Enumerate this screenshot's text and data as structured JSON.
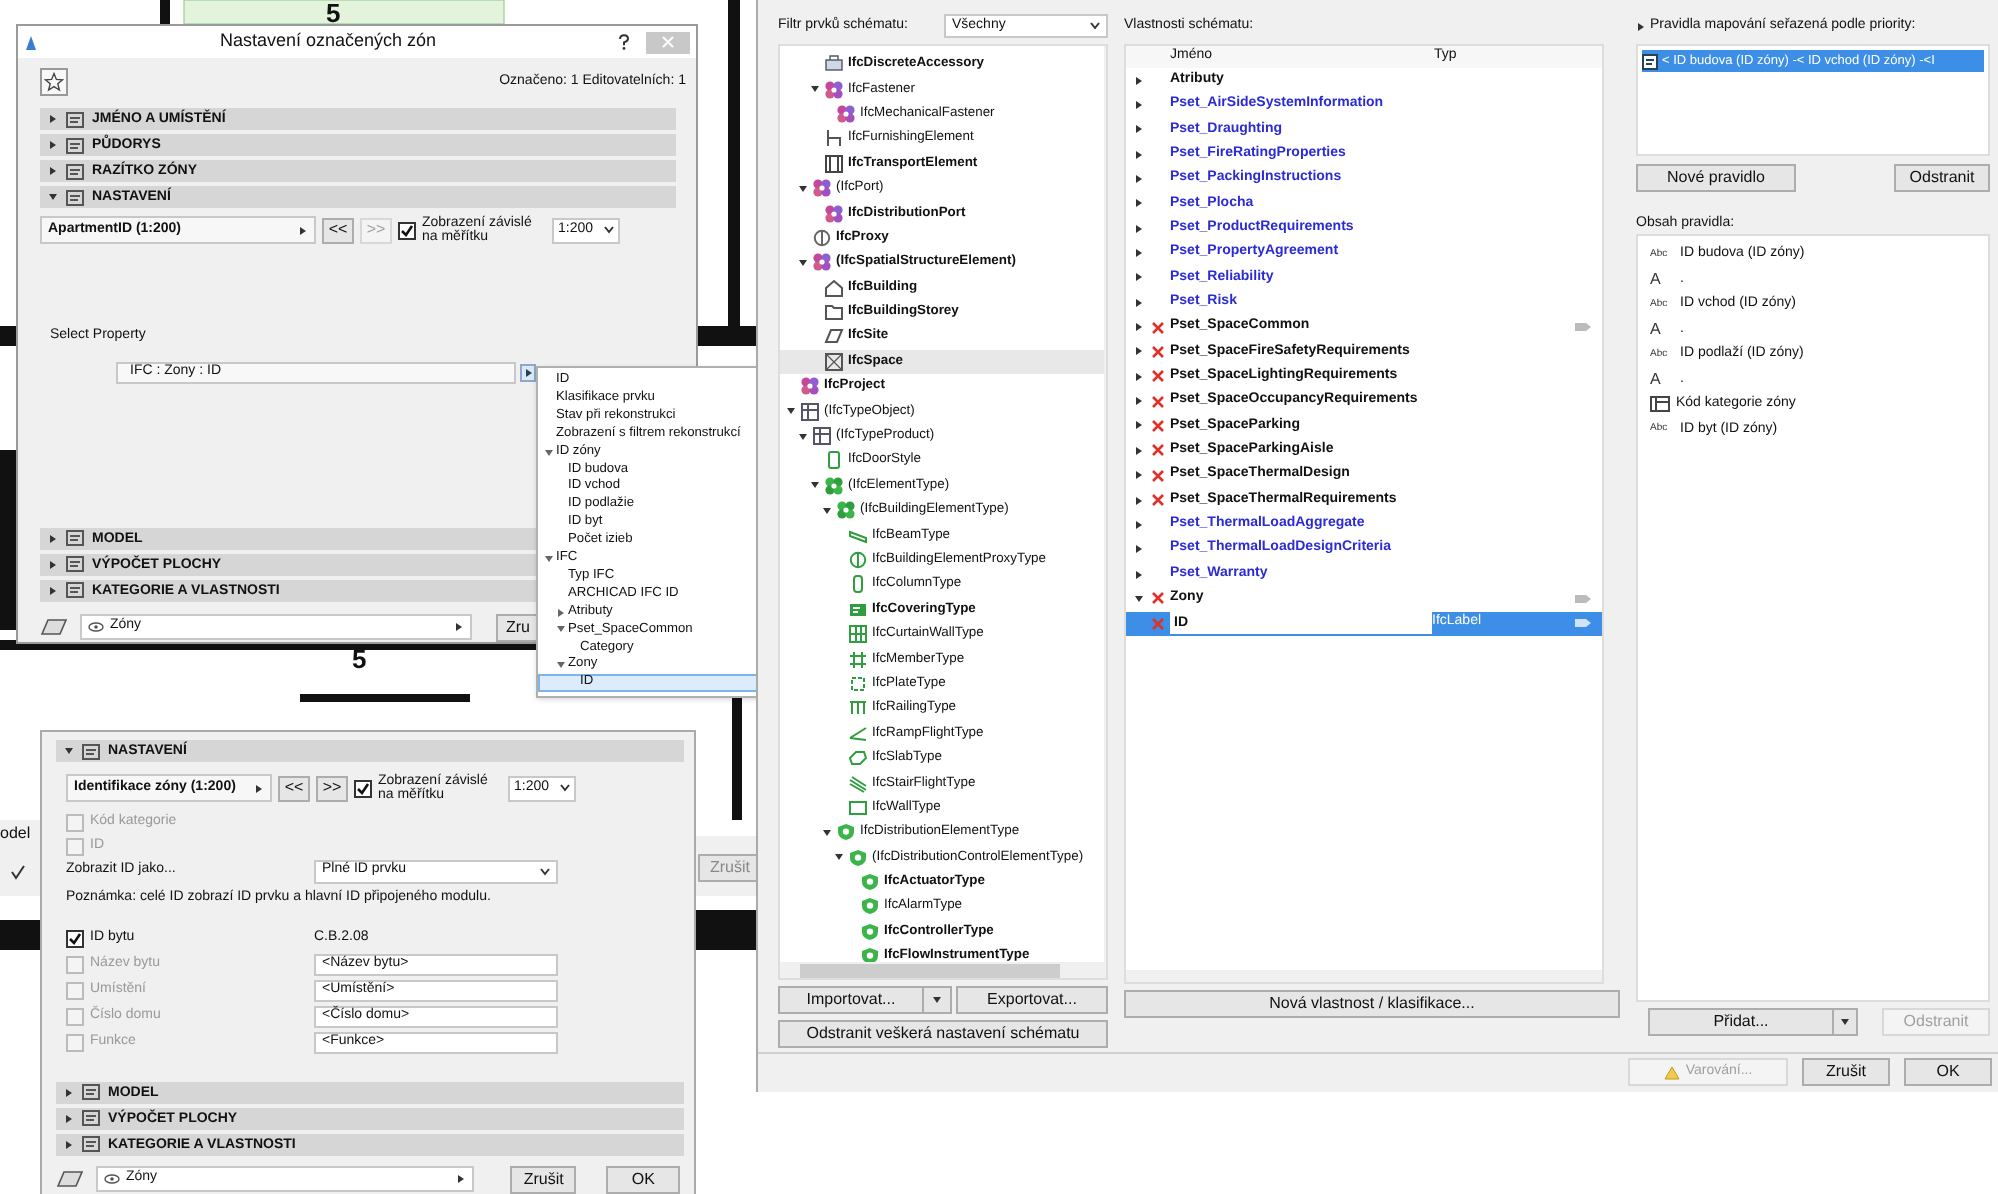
{
  "plan": {
    "room_numbers": [
      "5",
      "5"
    ]
  },
  "zone_dialog": {
    "title": "Nastavení označených zón",
    "selection_info": "Označeno: 1 Editovatelních: 1",
    "sections_top": [
      {
        "label": "JMÉNO A UMÍSTĚNÍ",
        "expanded": false
      },
      {
        "label": "PŮDORYS",
        "expanded": false
      },
      {
        "label": "RAZÍTKO ZÓNY",
        "expanded": false
      },
      {
        "label": "NASTAVENÍ",
        "expanded": true
      }
    ],
    "settings": {
      "preset": "ApartmentID (1:200)",
      "prev": {
        "label": "<<",
        "disabled": false
      },
      "next": {
        "label": ">>",
        "disabled": true
      },
      "scale_dependent": {
        "label": "Zobrazení závislé na měřítku",
        "checked": true
      },
      "scale": "1:200"
    },
    "select_property_label": "Select Property",
    "property_value": "IFC : Zony : ID",
    "sections_bottom": [
      {
        "label": "MODEL",
        "expanded": false
      },
      {
        "label": "VÝPOČET PLOCHY",
        "expanded": false
      },
      {
        "label": "KATEGORIE A VLASTNOSTI",
        "expanded": false
      }
    ],
    "layer": "Zóny",
    "cancel": "Zru"
  },
  "property_popup": {
    "items": [
      {
        "label": "ID",
        "selected": false
      },
      {
        "label": "Klasifikace prvku",
        "selected": false
      },
      {
        "label": "Stav při rekonstrukci",
        "selected": false
      },
      {
        "label": "Zobrazení s filtrem rekonstrukcí",
        "selected": false
      },
      {
        "label": "ID zóny",
        "selected": false,
        "expanded": true,
        "children": [
          {
            "label": "ID budova",
            "selected": false
          },
          {
            "label": "ID vchod",
            "selected": false
          },
          {
            "label": "ID podlažie",
            "selected": false
          },
          {
            "label": "ID byt",
            "selected": false
          },
          {
            "label": "Počet izieb",
            "selected": false
          }
        ]
      },
      {
        "label": "IFC",
        "selected": false,
        "expanded": true,
        "children": [
          {
            "label": "Typ IFC",
            "selected": false
          },
          {
            "label": "ARCHICAD IFC ID",
            "selected": false
          },
          {
            "label": "Atributy",
            "selected": false,
            "expanded": false
          },
          {
            "label": "Pset_SpaceCommon",
            "selected": false,
            "expanded": true,
            "children": [
              {
                "label": "Category",
                "selected": false
              }
            ]
          },
          {
            "label": "Zony",
            "selected": false,
            "expanded": true,
            "children": [
              {
                "label": "ID",
                "selected": true
              }
            ]
          }
        ]
      }
    ]
  },
  "behind_dialog": {
    "label": "odel",
    "cancel": "Zrušit"
  },
  "label_dialog": {
    "section": {
      "label": "NASTAVENÍ",
      "expanded": true
    },
    "settings": {
      "preset": "Identifikace zóny (1:200)",
      "prev": {
        "label": "<<",
        "disabled": false
      },
      "next": {
        "label": ">>",
        "disabled": false
      },
      "scale_dependent": {
        "label": "Zobrazení závislé na měřítku",
        "checked": true
      },
      "scale": "1:200"
    },
    "options": [
      {
        "label": "Kód kategorie",
        "checked": false
      },
      {
        "label": "ID",
        "checked": false
      }
    ],
    "display_id_label": "Zobrazit ID jako...",
    "display_id_value": "Plné ID prvku",
    "note": "Poznámka: celé ID zobrazí ID prvku a hlavní ID připojeného modulu.",
    "fields": [
      {
        "label": "ID bytu",
        "checked": true,
        "kind": "text",
        "value": "C.B.2.08"
      },
      {
        "label": "Název bytu",
        "checked": false,
        "kind": "input",
        "value": "<Název bytu>"
      },
      {
        "label": "Umístění",
        "checked": false,
        "kind": "input",
        "value": "<Umístění>"
      },
      {
        "label": "Číslo domu",
        "checked": false,
        "kind": "input",
        "value": "<Číslo domu>"
      },
      {
        "label": "Funkce",
        "checked": false,
        "kind": "input",
        "value": "<Funkce>"
      }
    ],
    "sections_bottom": [
      {
        "label": "MODEL",
        "expanded": false
      },
      {
        "label": "VÝPOČET PLOCHY",
        "expanded": false
      },
      {
        "label": "KATEGORIE A VLASTNOSTI",
        "expanded": false
      }
    ],
    "layer": "Zóny",
    "cancel": "Zrušit",
    "ok": "OK"
  },
  "schema_dialog": {
    "filter_label": "Filtr prvků schématu:",
    "filter_value": "Všechny",
    "tree": [
      {
        "children": [
          {
            "children": [
              {
                "label": "IfcDiscreteAccessory",
                "kind": "box",
                "bold": true,
                "selected": false
              },
              {
                "label": "IfcFastener",
                "kind": "element",
                "bold": false,
                "selected": false,
                "expanded": true,
                "children": [
                  {
                    "label": "IfcMechanicalFastener",
                    "kind": "element",
                    "bold": false,
                    "selected": false
                  }
                ]
              },
              {
                "label": "IfcFurnishingElement",
                "kind": "furniture",
                "bold": false,
                "selected": false
              },
              {
                "label": "IfcTransportElement",
                "kind": "frame",
                "bold": true,
                "selected": false
              }
            ]
          },
          {
            "label": "(IfcPort)",
            "kind": "element",
            "bold": false,
            "selected": false,
            "expanded": true,
            "children": [
              {
                "label": "IfcDistributionPort",
                "kind": "element",
                "bold": true,
                "selected": false
              }
            ]
          },
          {
            "label": "IfcProxy",
            "kind": "proxy",
            "bold": true,
            "selected": false
          },
          {
            "label": "(IfcSpatialStructureElement)",
            "kind": "element",
            "bold": true,
            "selected": false,
            "expanded": true,
            "children": [
              {
                "label": "IfcBuilding",
                "kind": "building",
                "bold": true,
                "selected": false
              },
              {
                "label": "IfcBuildingStorey",
                "kind": "folder",
                "bold": true,
                "selected": false
              },
              {
                "label": "IfcSite",
                "kind": "slab",
                "bold": true,
                "selected": false
              },
              {
                "label": "IfcSpace",
                "kind": "space",
                "bold": true,
                "selected": true
              }
            ]
          }
        ]
      },
      {
        "label": "IfcProject",
        "kind": "element",
        "bold": true,
        "selected": false
      },
      {
        "label": "(IfcTypeObject)",
        "kind": "table",
        "bold": false,
        "selected": false,
        "expanded": true,
        "children": [
          {
            "label": "(IfcTypeProduct)",
            "kind": "table",
            "bold": false,
            "selected": false,
            "expanded": true,
            "children": [
              {
                "label": "IfcDoorStyle",
                "kind": "door",
                "bold": false,
                "selected": false
              },
              {
                "label": "(IfcElementType)",
                "kind": "green_element",
                "bold": false,
                "selected": false,
                "expanded": true,
                "children": [
                  {
                    "label": "(IfcBuildingElementType)",
                    "kind": "green_element",
                    "bold": false,
                    "selected": false,
                    "expanded": true,
                    "children": [
                      {
                        "label": "IfcBeamType",
                        "kind": "beam",
                        "bold": false,
                        "selected": false
                      },
                      {
                        "label": "IfcBuildingElementProxyType",
                        "kind": "proxy_type",
                        "bold": false,
                        "selected": false
                      },
                      {
                        "label": "IfcColumnType",
                        "kind": "column",
                        "bold": false,
                        "selected": false
                      },
                      {
                        "label": "IfcCoveringType",
                        "kind": "covering",
                        "bold": true,
                        "selected": false
                      },
                      {
                        "label": "IfcCurtainWallType",
                        "kind": "grid",
                        "bold": false,
                        "selected": false
                      },
                      {
                        "label": "IfcMemberType",
                        "kind": "member",
                        "bold": false,
                        "selected": false
                      },
                      {
                        "label": "IfcPlateType",
                        "kind": "plate",
                        "bold": false,
                        "selected": false
                      },
                      {
                        "label": "IfcRailingType",
                        "kind": "railing",
                        "bold": false,
                        "selected": false
                      },
                      {
                        "label": "IfcRampFlightType",
                        "kind": "ramp",
                        "bold": false,
                        "selected": false
                      },
                      {
                        "label": "IfcSlabType",
                        "kind": "slab_type",
                        "bold": false,
                        "selected": false
                      },
                      {
                        "label": "IfcStairFlightType",
                        "kind": "stair",
                        "bold": false,
                        "selected": false
                      },
                      {
                        "label": "IfcWallType",
                        "kind": "wall",
                        "bold": false,
                        "selected": false
                      }
                    ]
                  },
                  {
                    "label": "IfcDistributionElementType",
                    "kind": "shield",
                    "bold": false,
                    "selected": false,
                    "expanded": true,
                    "children": [
                      {
                        "label": "(IfcDistributionControlElementType)",
                        "kind": "shield",
                        "bold": false,
                        "selected": false,
                        "expanded": true,
                        "children": [
                          {
                            "label": "IfcActuatorType",
                            "kind": "shield",
                            "bold": true,
                            "selected": false
                          },
                          {
                            "label": "IfcAlarmType",
                            "kind": "shield",
                            "bold": false,
                            "selected": false
                          },
                          {
                            "label": "IfcControllerType",
                            "kind": "shield",
                            "bold": true,
                            "selected": false
                          },
                          {
                            "label": "IfcFlowInstrumentType",
                            "kind": "shield",
                            "bold": true,
                            "selected": false
                          }
                        ]
                      }
                    ]
                  }
                ]
              }
            ]
          }
        ]
      }
    ],
    "import": "Importovat...",
    "export": "Exportovat...",
    "reset": "Odstranit veškerá nastavení schématu",
    "properties_label": "Vlastnosti schématu:",
    "columns": [
      "Jméno",
      "Typ"
    ],
    "properties": [
      {
        "name": "Atributy",
        "kind": "builtin",
        "expanded": false,
        "linked": false,
        "selected": false
      },
      {
        "name": "Pset_AirSideSystemInformation",
        "kind": "standard",
        "expanded": false,
        "linked": false,
        "selected": false
      },
      {
        "name": "Pset_Draughting",
        "kind": "standard",
        "expanded": false,
        "linked": false,
        "selected": false
      },
      {
        "name": "Pset_FireRatingProperties",
        "kind": "standard",
        "expanded": false,
        "linked": false,
        "selected": false
      },
      {
        "name": "Pset_PackingInstructions",
        "kind": "standard",
        "expanded": false,
        "linked": false,
        "selected": false
      },
      {
        "name": "Pset_Plocha",
        "kind": "standard",
        "expanded": false,
        "linked": false,
        "selected": false
      },
      {
        "name": "Pset_ProductRequirements",
        "kind": "standard",
        "expanded": false,
        "linked": false,
        "selected": false
      },
      {
        "name": "Pset_PropertyAgreement",
        "kind": "standard",
        "expanded": false,
        "linked": false,
        "selected": false
      },
      {
        "name": "Pset_Reliability",
        "kind": "standard",
        "expanded": false,
        "linked": false,
        "selected": false
      },
      {
        "name": "Pset_Risk",
        "kind": "standard",
        "expanded": false,
        "linked": false,
        "selected": false
      },
      {
        "name": "Pset_SpaceCommon",
        "kind": "custom",
        "expanded": false,
        "linked": true,
        "selected": false
      },
      {
        "name": "Pset_SpaceFireSafetyRequirements",
        "kind": "custom",
        "expanded": false,
        "linked": false,
        "selected": false
      },
      {
        "name": "Pset_SpaceLightingRequirements",
        "kind": "custom",
        "expanded": false,
        "linked": false,
        "selected": false
      },
      {
        "name": "Pset_SpaceOccupancyRequirements",
        "kind": "custom",
        "expanded": false,
        "linked": false,
        "selected": false
      },
      {
        "name": "Pset_SpaceParking",
        "kind": "custom",
        "expanded": false,
        "linked": false,
        "selected": false
      },
      {
        "name": "Pset_SpaceParkingAisle",
        "kind": "custom",
        "expanded": false,
        "linked": false,
        "selected": false
      },
      {
        "name": "Pset_SpaceThermalDesign",
        "kind": "custom",
        "expanded": false,
        "linked": false,
        "selected": false
      },
      {
        "name": "Pset_SpaceThermalRequirements",
        "kind": "custom",
        "expanded": false,
        "linked": false,
        "selected": false
      },
      {
        "name": "Pset_ThermalLoadAggregate",
        "kind": "standard",
        "expanded": false,
        "linked": false,
        "selected": false
      },
      {
        "name": "Pset_ThermalLoadDesignCriteria",
        "kind": "standard",
        "expanded": false,
        "linked": false,
        "selected": false
      },
      {
        "name": "Pset_Warranty",
        "kind": "standard",
        "expanded": false,
        "linked": false,
        "selected": false
      },
      {
        "name": "Zony",
        "kind": "custom",
        "expanded": true,
        "linked": true,
        "selected": false,
        "children": [
          {
            "name": "ID",
            "kind": "custom_field",
            "type": "IfcLabel",
            "linked": true,
            "selected": true
          }
        ]
      }
    ],
    "new_property": "Nová vlastnost / klasifikace...",
    "rules_label": "Pravidla mapování seřazená podle priority:",
    "rules": [
      {
        "text": "< ID budova (ID zóny) -< ID vchod (ID zóny) -<I",
        "selected": true
      }
    ],
    "new_rule": "Nové pravidlo",
    "remove_rule": {
      "label": "Odstranit",
      "disabled": false
    },
    "rule_content_label": "Obsah pravidla:",
    "rule_content": [
      {
        "kind": "property",
        "badge": "Abc",
        "text": "ID budova (ID zóny)"
      },
      {
        "kind": "separator",
        "badge": "A",
        "text": "."
      },
      {
        "kind": "property",
        "badge": "Abc",
        "text": "ID vchod (ID zóny)"
      },
      {
        "kind": "separator",
        "badge": "A",
        "text": "."
      },
      {
        "kind": "property",
        "badge": "Abc",
        "text": "ID podlaží (ID zóny)"
      },
      {
        "kind": "separator",
        "badge": "A",
        "text": "."
      },
      {
        "kind": "classification",
        "text": "Kód kategorie zóny"
      },
      {
        "kind": "property",
        "badge": "Abc",
        "text": "ID byt (ID zóny)"
      }
    ],
    "add": "Přidat...",
    "remove": {
      "label": "Odstranit",
      "disabled": true
    },
    "warnings": {
      "label": "Varování...",
      "disabled": true
    },
    "cancel": "Zrušit",
    "ok": "OK"
  }
}
